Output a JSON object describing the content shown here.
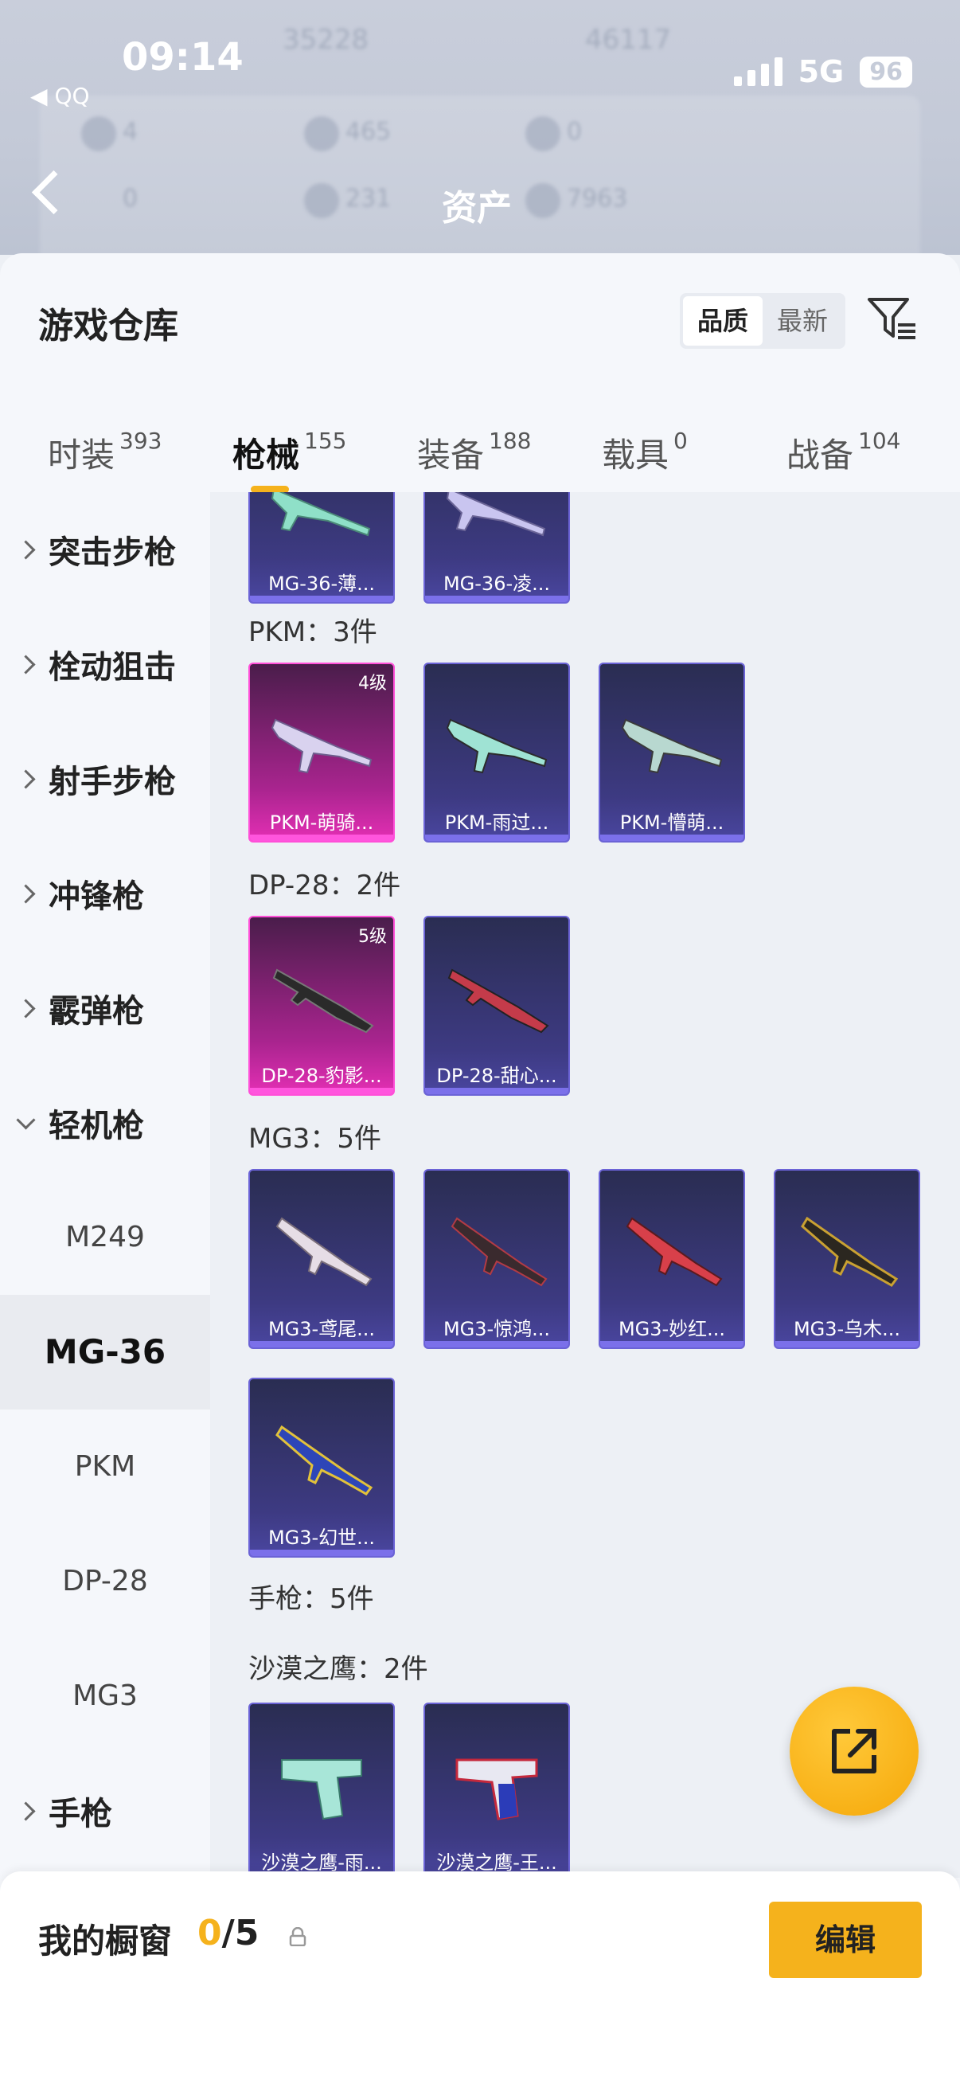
{
  "status": {
    "time": "09:14",
    "back_app": "QQ",
    "network": "5G",
    "battery": "96"
  },
  "header": {
    "title": "资产",
    "blurred": [
      "35228",
      "46117",
      "4",
      "465",
      "0",
      "0",
      "231",
      "7963"
    ]
  },
  "sheet": {
    "title": "游戏仓库",
    "sort_options": [
      "品质",
      "最新"
    ],
    "sort_selected": "品质",
    "tabs": [
      {
        "label": "时装",
        "count": "393"
      },
      {
        "label": "枪械",
        "count": "155"
      },
      {
        "label": "装备",
        "count": "188"
      },
      {
        "label": "载具",
        "count": "0"
      },
      {
        "label": "战备",
        "count": "104"
      }
    ],
    "active_tab": "枪械"
  },
  "sidebar": {
    "categories": [
      {
        "label": "突击步枪"
      },
      {
        "label": "栓动狙击"
      },
      {
        "label": "射手步枪"
      },
      {
        "label": "冲锋枪"
      },
      {
        "label": "霰弹枪"
      },
      {
        "label": "轻机枪"
      }
    ],
    "subitems": [
      {
        "label": "M249"
      },
      {
        "label": "MG-36"
      },
      {
        "label": "PKM"
      },
      {
        "label": "DP-28"
      },
      {
        "label": "MG3"
      }
    ],
    "selected_subitem": "MG-36",
    "last_category": {
      "label": "手枪"
    }
  },
  "content": {
    "top_row": [
      {
        "name": "MG-36-薄..."
      },
      {
        "name": "MG-36-凌..."
      }
    ],
    "groups": [
      {
        "title": "PKM：3件",
        "items": [
          {
            "name": "PKM-萌骑...",
            "level": "4级",
            "rarity": "pink"
          },
          {
            "name": "PKM-雨过...",
            "rarity": "purple"
          },
          {
            "name": "PKM-懵萌...",
            "rarity": "purple"
          }
        ]
      },
      {
        "title": "DP-28：2件",
        "items": [
          {
            "name": "DP-28-豹影...",
            "level": "5级",
            "rarity": "pink"
          },
          {
            "name": "DP-28-甜心...",
            "rarity": "purple"
          }
        ]
      },
      {
        "title": "MG3：5件",
        "items": [
          {
            "name": "MG3-鸢尾...",
            "rarity": "purple"
          },
          {
            "name": "MG3-惊鸿...",
            "rarity": "purple"
          },
          {
            "name": "MG3-妙红...",
            "rarity": "purple"
          },
          {
            "name": "MG3-乌木...",
            "rarity": "purple"
          },
          {
            "name": "MG3-幻世...",
            "rarity": "purple"
          }
        ]
      }
    ],
    "section_title": "手枪：5件",
    "desert_eagle": {
      "title": "沙漠之鹰：2件",
      "items": [
        {
          "name": "沙漠之鹰-雨..."
        },
        {
          "name": "沙漠之鹰-王..."
        }
      ]
    }
  },
  "bottom": {
    "label": "我的橱窗",
    "count_current": "0",
    "count_total": "/5",
    "edit_label": "编辑"
  },
  "colors": {
    "accent": "#f5b21c",
    "card_purple": "#3d3a82",
    "card_pink": "#e42fb4"
  }
}
